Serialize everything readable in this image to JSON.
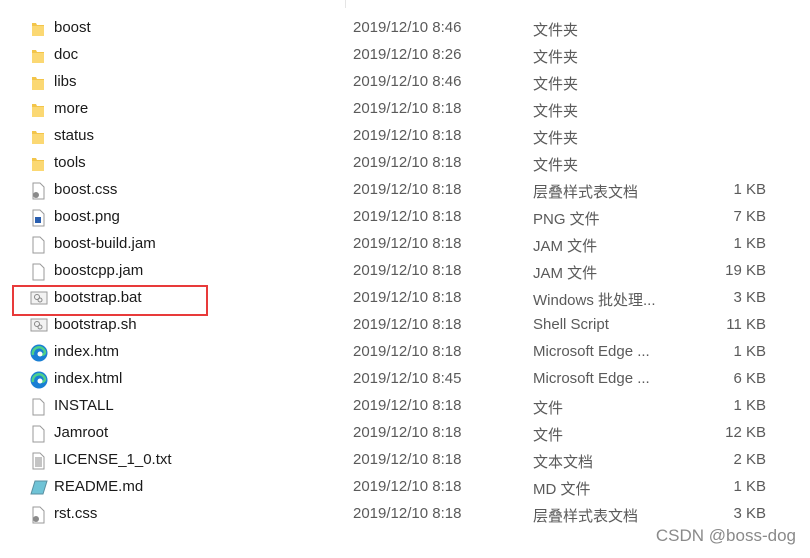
{
  "files": [
    {
      "name": "boost",
      "date": "2019/12/10 8:46",
      "type": "文件夹",
      "size": "",
      "icon": "folder-icon"
    },
    {
      "name": "doc",
      "date": "2019/12/10 8:26",
      "type": "文件夹",
      "size": "",
      "icon": "folder-icon"
    },
    {
      "name": "libs",
      "date": "2019/12/10 8:46",
      "type": "文件夹",
      "size": "",
      "icon": "folder-icon"
    },
    {
      "name": "more",
      "date": "2019/12/10 8:18",
      "type": "文件夹",
      "size": "",
      "icon": "folder-icon"
    },
    {
      "name": "status",
      "date": "2019/12/10 8:18",
      "type": "文件夹",
      "size": "",
      "icon": "folder-icon"
    },
    {
      "name": "tools",
      "date": "2019/12/10 8:18",
      "type": "文件夹",
      "size": "",
      "icon": "folder-icon"
    },
    {
      "name": "boost.css",
      "date": "2019/12/10 8:18",
      "type": "层叠样式表文档",
      "size": "1 KB",
      "icon": "css-file-icon"
    },
    {
      "name": "boost.png",
      "date": "2019/12/10 8:18",
      "type": "PNG 文件",
      "size": "7 KB",
      "icon": "image-file-icon"
    },
    {
      "name": "boost-build.jam",
      "date": "2019/12/10 8:18",
      "type": "JAM 文件",
      "size": "1 KB",
      "icon": "blank-file-icon"
    },
    {
      "name": "boostcpp.jam",
      "date": "2019/12/10 8:18",
      "type": "JAM 文件",
      "size": "19 KB",
      "icon": "blank-file-icon"
    },
    {
      "name": "bootstrap.bat",
      "date": "2019/12/10 8:18",
      "type": "Windows 批处理...",
      "size": "3 KB",
      "icon": "script-file-icon"
    },
    {
      "name": "bootstrap.sh",
      "date": "2019/12/10 8:18",
      "type": "Shell Script",
      "size": "11 KB",
      "icon": "script-file-icon"
    },
    {
      "name": "index.htm",
      "date": "2019/12/10 8:18",
      "type": "Microsoft Edge ...",
      "size": "1 KB",
      "icon": "edge-icon"
    },
    {
      "name": "index.html",
      "date": "2019/12/10 8:45",
      "type": "Microsoft Edge ...",
      "size": "6 KB",
      "icon": "edge-icon"
    },
    {
      "name": "INSTALL",
      "date": "2019/12/10 8:18",
      "type": "文件",
      "size": "1 KB",
      "icon": "blank-file-icon"
    },
    {
      "name": "Jamroot",
      "date": "2019/12/10 8:18",
      "type": "文件",
      "size": "12 KB",
      "icon": "blank-file-icon"
    },
    {
      "name": "LICENSE_1_0.txt",
      "date": "2019/12/10 8:18",
      "type": "文本文档",
      "size": "2 KB",
      "icon": "text-file-icon"
    },
    {
      "name": "README.md",
      "date": "2019/12/10 8:18",
      "type": "MD 文件",
      "size": "1 KB",
      "icon": "notepad-file-icon"
    },
    {
      "name": "rst.css",
      "date": "2019/12/10 8:18",
      "type": "层叠样式表文档",
      "size": "3 KB",
      "icon": "css-file-icon"
    }
  ],
  "highlighted": "bootstrap.bat",
  "highlight_color": "#e83a3a",
  "watermark": "CSDN @boss-dog"
}
